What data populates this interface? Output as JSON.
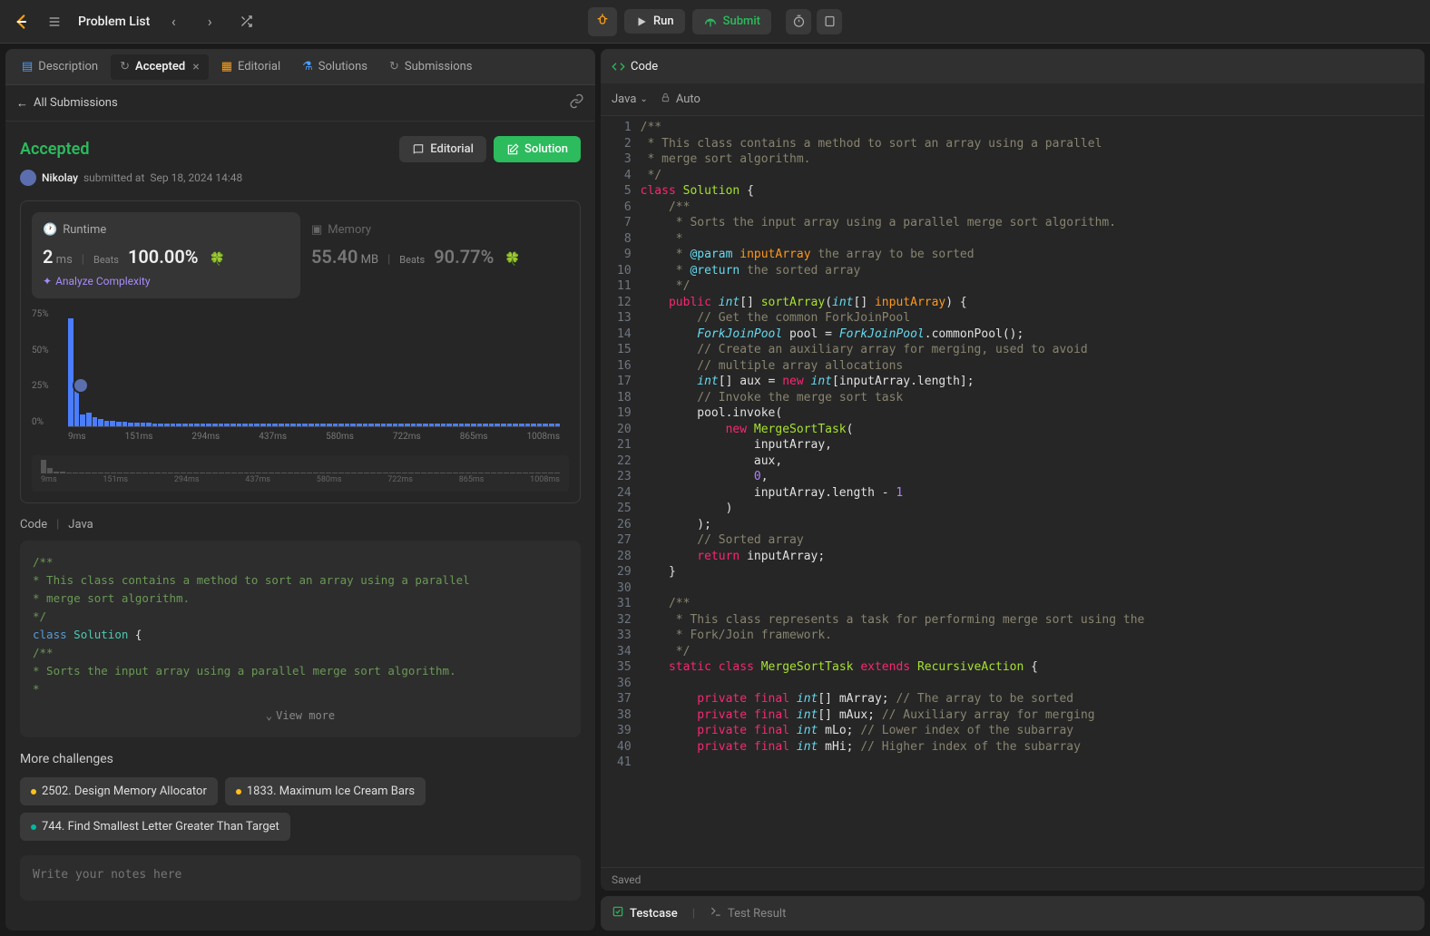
{
  "topbar": {
    "problem_list": "Problem List",
    "run": "Run",
    "submit": "Submit"
  },
  "left_tabs": {
    "description": "Description",
    "accepted": "Accepted",
    "editorial": "Editorial",
    "solutions": "Solutions",
    "submissions": "Submissions"
  },
  "back_link": "All Submissions",
  "status": {
    "title": "Accepted",
    "user": "Nikolay",
    "submitted_prefix": "submitted at",
    "submitted_time": "Sep 18, 2024 14:48"
  },
  "buttons": {
    "editorial": "Editorial",
    "solution": "Solution"
  },
  "runtime": {
    "label": "Runtime",
    "value": "2",
    "unit": "ms",
    "beats_label": "Beats",
    "beats_pct": "100.00%",
    "analyze": "Analyze Complexity"
  },
  "memory": {
    "label": "Memory",
    "value": "55.40",
    "unit": "MB",
    "beats_label": "Beats",
    "beats_pct": "90.77%"
  },
  "chart_data": {
    "type": "bar",
    "ylabels": [
      "75%",
      "50%",
      "25%",
      "0%"
    ],
    "xlabels": [
      "9ms",
      "151ms",
      "294ms",
      "437ms",
      "580ms",
      "722ms",
      "865ms",
      "1008ms"
    ],
    "bars": [
      92,
      38,
      10,
      12,
      8,
      6,
      5,
      5,
      4,
      4,
      3,
      3,
      3,
      3,
      2,
      2,
      2,
      2,
      2,
      2,
      2,
      2,
      2,
      2,
      2,
      2,
      2,
      2,
      2,
      2,
      2,
      2,
      2,
      2,
      2,
      2,
      2,
      2,
      2,
      2,
      2,
      2,
      2,
      2,
      2,
      2,
      2,
      2,
      2,
      2,
      2,
      2,
      2,
      2,
      2,
      2,
      2,
      2,
      2,
      2,
      2,
      2,
      2,
      2,
      2,
      2,
      2,
      2,
      2,
      2,
      2,
      2,
      2,
      2,
      2,
      2,
      2,
      2,
      2,
      2,
      2,
      2
    ],
    "minimap_labels": [
      "9ms",
      "151ms",
      "294ms",
      "437ms",
      "580ms",
      "722ms",
      "865ms",
      "1008ms"
    ]
  },
  "code_label": {
    "code": "Code",
    "lang": "Java"
  },
  "code_preview": [
    {
      "cls": "cm",
      "text": "/**"
    },
    {
      "cls": "cm",
      "text": " * This class contains a method to sort an array using a parallel"
    },
    {
      "cls": "cm",
      "text": " * merge sort algorithm."
    },
    {
      "cls": "cm",
      "text": " */"
    },
    {
      "cls": "",
      "html": "<span class='kw'>class</span> <span class='cls'>Solution</span> {"
    },
    {
      "cls": "cm",
      "text": "    /**"
    },
    {
      "cls": "cm",
      "text": "     * Sorts the input array using a parallel merge sort algorithm."
    },
    {
      "cls": "cm",
      "text": "     *"
    }
  ],
  "view_more": "View more",
  "more_challenges": "More challenges",
  "challenges": [
    {
      "dot": "yellow",
      "text": "2502. Design Memory Allocator"
    },
    {
      "dot": "yellow",
      "text": "1833. Maximum Ice Cream Bars"
    },
    {
      "dot": "teal",
      "text": "744. Find Smallest Letter Greater Than Target"
    }
  ],
  "notes_placeholder": "Write your notes here",
  "right": {
    "code_tab": "Code",
    "lang": "Java",
    "auto": "Auto",
    "saved": "Saved"
  },
  "editor_lines": [
    "<span class='doc'>/**</span>",
    "<span class='doc'> * This class contains a method to sort an array using a parallel</span>",
    "<span class='doc'> * merge sort algorithm.</span>",
    "<span class='doc'> */</span>",
    "<span class='kw'>class</span> <span class='cls'>Solution</span> {",
    "    <span class='doc'>/**</span>",
    "    <span class='doc'> * Sorts the input array using a parallel merge sort algorithm.</span>",
    "    <span class='doc'> *</span>",
    "    <span class='doc'> * <span class='tag'>@param</span> <span class='var'>inputArray</span> the array to be sorted</span>",
    "    <span class='doc'> * <span class='tag'>@return</span> the sorted array</span>",
    "    <span class='doc'> */</span>",
    "    <span class='kw'>public</span> <span class='typ'>int</span>[] <span class='fn'>sortArray</span>(<span class='typ'>int</span>[] <span class='var'>inputArray</span>) {",
    "        <span class='cm'>// Get the common ForkJoinPool</span>",
    "        <span class='typ'>ForkJoinPool</span> pool = <span class='typ'>ForkJoinPool</span>.commonPool();",
    "        <span class='cm'>// Create an auxiliary array for merging, used to avoid</span>",
    "        <span class='cm'>// multiple array allocations</span>",
    "        <span class='typ'>int</span>[] aux = <span class='kw'>new</span> <span class='typ'>int</span>[inputArray.length];",
    "        <span class='cm'>// Invoke the merge sort task</span>",
    "        pool.invoke(",
    "            <span class='kw'>new</span> <span class='cls'>MergeSortTask</span>(",
    "                inputArray,",
    "                aux,",
    "                <span class='num'>0</span>,",
    "                inputArray.length - <span class='num'>1</span>",
    "            )",
    "        );",
    "        <span class='cm'>// Sorted array</span>",
    "        <span class='kw'>return</span> inputArray;",
    "    }",
    "",
    "    <span class='doc'>/**</span>",
    "    <span class='doc'> * This class represents a task for performing merge sort using the</span>",
    "    <span class='doc'> * Fork/Join framework.</span>",
    "    <span class='doc'> */</span>",
    "    <span class='kw'>static</span> <span class='kw'>class</span> <span class='cls'>MergeSortTask</span> <span class='kw'>extends</span> <span class='cls'>RecursiveAction</span> {",
    "",
    "        <span class='kw'>private</span> <span class='kw'>final</span> <span class='typ'>int</span>[] mArray; <span class='cm'>// The array to be sorted</span>",
    "        <span class='kw'>private</span> <span class='kw'>final</span> <span class='typ'>int</span>[] mAux; <span class='cm'>// Auxiliary array for merging</span>",
    "        <span class='kw'>private</span> <span class='kw'>final</span> <span class='typ'>int</span> mLo; <span class='cm'>// Lower index of the subarray</span>",
    "        <span class='kw'>private</span> <span class='kw'>final</span> <span class='typ'>int</span> mHi; <span class='cm'>// Higher index of the subarray</span>",
    ""
  ],
  "bottom_tabs": {
    "testcase": "Testcase",
    "result": "Test Result"
  }
}
